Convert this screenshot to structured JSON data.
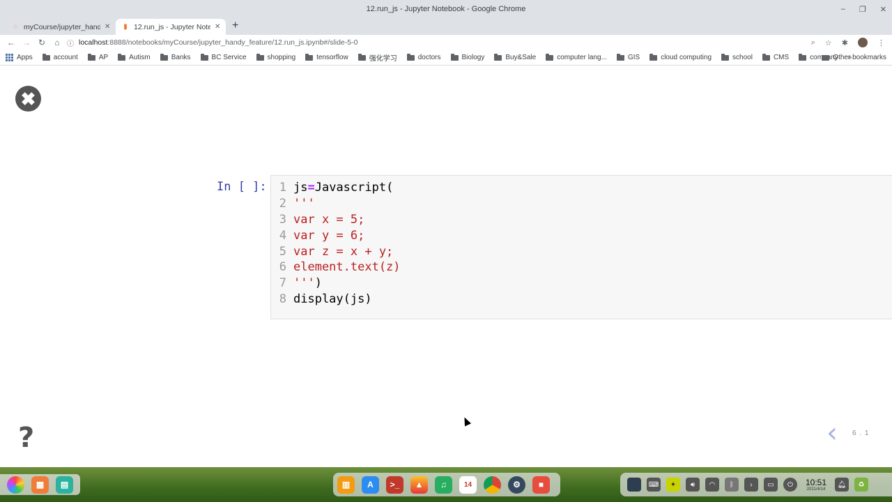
{
  "window": {
    "title": "12.run_js - Jupyter Notebook - Google Chrome",
    "controls": {
      "minimize": "–",
      "restore": "❐",
      "close": "✕"
    }
  },
  "tabs": [
    {
      "label": "myCourse/jupyter_handy_feature/",
      "close": "✕",
      "active": false,
      "icon": "jupyter-logo-icon"
    },
    {
      "label": "12.run_js - Jupyter Notebook",
      "close": "✕",
      "active": true,
      "icon": "notebook-icon"
    }
  ],
  "new_tab": "+",
  "nav": {
    "back": "←",
    "forward": "→",
    "reload": "↻",
    "home": "⌂"
  },
  "address": {
    "host": "localhost",
    "path": ":8888/notebooks/myCourse/jupyter_handy_feature/12.run_js.ipynb#/slide-5-0"
  },
  "toolbar_icons": {
    "zoom": "⌕",
    "bookmark_star": "☆",
    "extensions": "✱",
    "menu": "⋮"
  },
  "bookmarks": {
    "items": [
      "Apps",
      "account",
      "AP",
      "Autism",
      "Banks",
      "BC Service",
      "shopping",
      "tensorflow",
      "强化学习",
      "doctors",
      "Biology",
      "Buy&Sale",
      "computer lang...",
      "GIS",
      "cloud computing",
      "school",
      "CMS",
      "company"
    ],
    "more": "»",
    "other": "Other bookmarks"
  },
  "slide": {
    "close_glyph": "✖",
    "help_glyph": "?",
    "prompt": "In [ ]:",
    "code_lines": [
      {
        "num": "1",
        "tokens": [
          {
            "t": "js",
            "k": "plain"
          },
          {
            "t": "=",
            "k": "op"
          },
          {
            "t": "Javascript(",
            "k": "plain"
          }
        ]
      },
      {
        "num": "2",
        "tokens": [
          {
            "t": "'''",
            "k": "str"
          }
        ]
      },
      {
        "num": "3",
        "tokens": [
          {
            "t": "var x = 5;",
            "k": "str"
          }
        ]
      },
      {
        "num": "4",
        "tokens": [
          {
            "t": "var y = 6;",
            "k": "str"
          }
        ]
      },
      {
        "num": "5",
        "tokens": [
          {
            "t": "var z = x + y;",
            "k": "str"
          }
        ]
      },
      {
        "num": "6",
        "tokens": [
          {
            "t": "element.text(z)",
            "k": "str"
          }
        ]
      },
      {
        "num": "7",
        "tokens": [
          {
            "t": "'''",
            "k": "str"
          },
          {
            "t": ")",
            "k": "plain"
          }
        ]
      },
      {
        "num": "8",
        "tokens": [
          {
            "t": "display(js)",
            "k": "plain"
          }
        ]
      }
    ],
    "nav_prev_glyph": "‹",
    "slide_number": "6 . 1"
  },
  "taskbar": {
    "clock_time": "10:51",
    "clock_date": "2021/4/14",
    "calendar_day": "14",
    "terminal_glyph": ">_",
    "dock_left": [
      "launcher-icon",
      "multitask-view-icon",
      "desktop-icon"
    ],
    "dock_center": [
      "file-manager-icon",
      "app-store-icon",
      "terminal-icon",
      "image-viewer-icon",
      "music-icon",
      "calendar-icon",
      "chrome-icon",
      "settings-icon",
      "screen-recorder-icon"
    ],
    "tray": [
      "tray-app-icon",
      "keyboard-icon",
      "input-method-icon",
      "volume-icon",
      "wifi-icon",
      "bluetooth-icon",
      "expand-tray-icon",
      "screenshot-icon",
      "power-icon",
      "notification-bell-icon",
      "trash-icon"
    ]
  },
  "colors": {
    "chrome_frame": "#dee1e6",
    "prompt_blue": "#303f9f",
    "code_bg": "#f7f7f7",
    "string_red": "#ba2121",
    "operator_purple": "#aa22ff",
    "slide_nav": "#a9b3de"
  }
}
